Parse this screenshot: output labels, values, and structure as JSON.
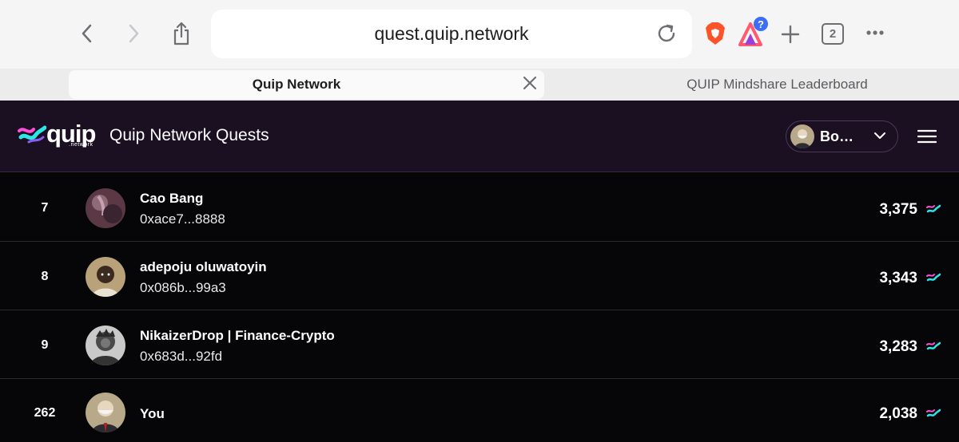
{
  "browser": {
    "url": "quest.quip.network",
    "tab_count": "2",
    "tabs": [
      {
        "label": "Quip Network"
      },
      {
        "label": "QUIP Mindshare Leaderboard"
      }
    ]
  },
  "app": {
    "logo_text": "quip",
    "logo_subtext": ".network",
    "title": "Quip Network Quests",
    "user_label": "Bo…"
  },
  "leaderboard": {
    "rows": [
      {
        "rank": "7",
        "name": "Cao Bang",
        "address": "0xace7...8888",
        "points": "3,375"
      },
      {
        "rank": "8",
        "name": "adepoju oluwatoyin",
        "address": "0x086b...99a3",
        "points": "3,343"
      },
      {
        "rank": "9",
        "name": "NikaizerDrop | Finance-Crypto",
        "address": "0x683d...92fd",
        "points": "3,283"
      },
      {
        "rank": "262",
        "name": "You",
        "address": "",
        "points": "2,038"
      }
    ]
  },
  "colors": {
    "header_bg": "#1b0f22",
    "accent_cyan": "#2fe6e6",
    "accent_pink": "#ff4fd8"
  }
}
